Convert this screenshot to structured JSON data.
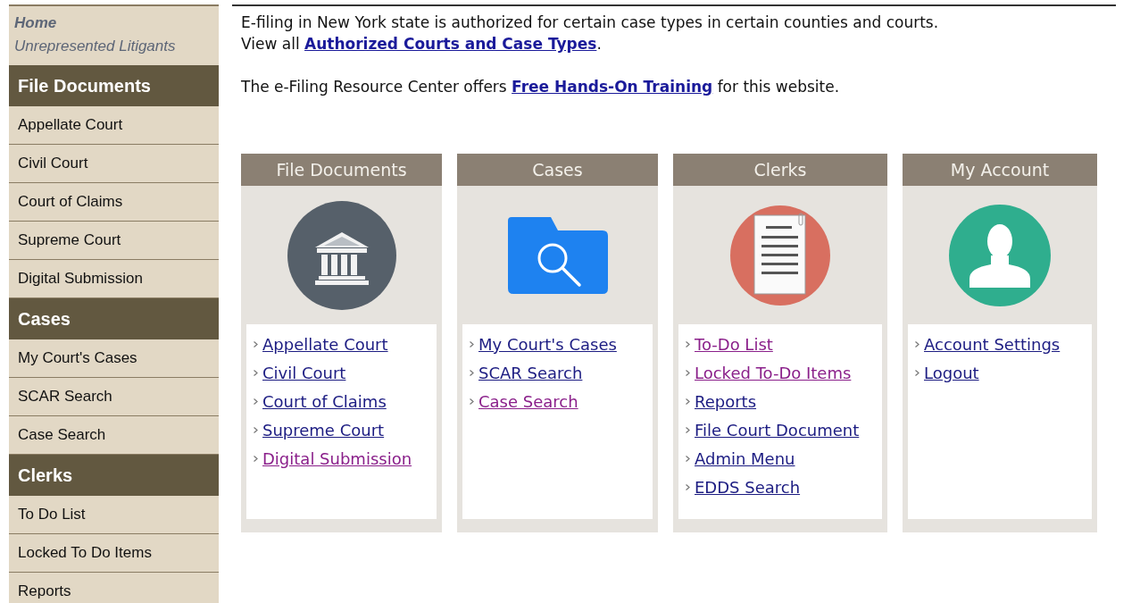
{
  "sidebar": {
    "top_links": [
      {
        "label": "Home",
        "kind": "bold"
      },
      {
        "label": "Unrepresented Litigants",
        "kind": "plain"
      }
    ],
    "groups": [
      {
        "title": "File Documents",
        "items": [
          "Appellate Court",
          "Civil Court",
          "Court of Claims",
          "Supreme Court",
          "Digital Submission"
        ]
      },
      {
        "title": "Cases",
        "items": [
          "My Court's Cases",
          "SCAR Search",
          "Case Search"
        ]
      },
      {
        "title": "Clerks",
        "items": [
          "To Do List",
          "Locked To Do Items",
          "Reports"
        ]
      }
    ]
  },
  "intro": {
    "line1": "E-filing in New York state is authorized for certain case types in certain counties and courts.",
    "line2_before": "View all ",
    "line2_link": "Authorized Courts and Case Types",
    "line2_after": ".",
    "training_before": "The e-Filing Resource Center offers ",
    "training_link": "Free Hands-On Training",
    "training_after": " for this website."
  },
  "cards": [
    {
      "title": "File Documents",
      "kind": "courthouse",
      "links": [
        {
          "label": "Appellate Court",
          "visited": false
        },
        {
          "label": "Civil Court",
          "visited": false
        },
        {
          "label": "Court of Claims",
          "visited": false
        },
        {
          "label": "Supreme Court",
          "visited": false
        },
        {
          "label": "Digital Submission",
          "visited": true
        }
      ]
    },
    {
      "title": "Cases",
      "kind": "folder",
      "links": [
        {
          "label": "My Court's Cases",
          "visited": false
        },
        {
          "label": "SCAR Search",
          "visited": false
        },
        {
          "label": "Case Search",
          "visited": true
        }
      ]
    },
    {
      "title": "Clerks",
      "kind": "document",
      "links": [
        {
          "label": "To-Do List",
          "visited": true
        },
        {
          "label": "Locked To-Do Items",
          "visited": true
        },
        {
          "label": "Reports",
          "visited": false
        },
        {
          "label": "File Court Document",
          "visited": false
        },
        {
          "label": "Admin Menu",
          "visited": false
        },
        {
          "label": "EDDS Search",
          "visited": false
        }
      ]
    },
    {
      "title": "My Account",
      "kind": "person",
      "links": [
        {
          "label": "Account Settings",
          "visited": false
        },
        {
          "label": "Logout",
          "visited": false
        }
      ]
    }
  ]
}
